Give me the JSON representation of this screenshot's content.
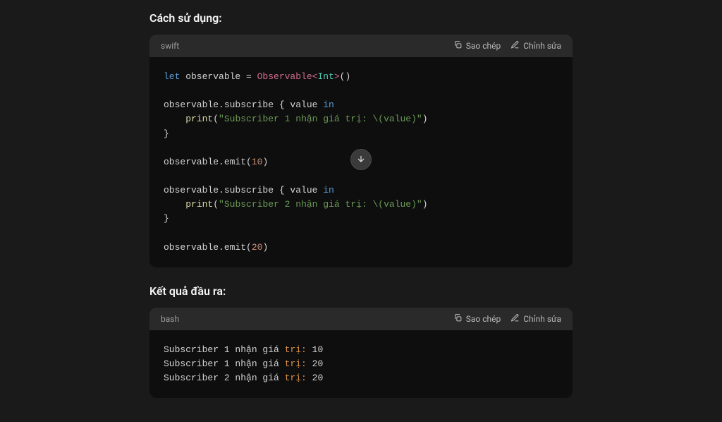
{
  "section1": {
    "heading": "Cách sử dụng:",
    "lang": "swift",
    "copy": "Sao chép",
    "edit": "Chỉnh sửa",
    "tokens": {
      "let": "let",
      "observable": " observable = ",
      "Observable": "Observable",
      "lt": "<",
      "Int": "Int",
      "gt": ">",
      "parens": "()",
      "line3a": "observable.subscribe { value ",
      "in": "in",
      "print": "print",
      "open": "(",
      "str1": "\"Subscriber 1 nhận giá trị: \\(value)\"",
      "close": ")",
      "brace": "}",
      "line7a": "observable.emit(",
      "ten": "10",
      "closeParen": ")",
      "line9a": "observable.subscribe { value ",
      "str2": "\"Subscriber 2 nhận giá trị: \\(value)\"",
      "line13a": "observable.emit(",
      "twenty": "20"
    }
  },
  "section2": {
    "heading": "Kết quả đầu ra:",
    "lang": "bash",
    "copy": "Sao chép",
    "edit": "Chỉnh sửa",
    "lines": {
      "l1a": "Subscriber 1 nhận giá ",
      "l1b": "trị:",
      "l1c": " 10",
      "l2a": "Subscriber 1 nhận giá ",
      "l2b": "trị:",
      "l2c": " 20",
      "l3a": "Subscriber 2 nhận giá ",
      "l3b": "trị:",
      "l3c": " 20"
    }
  }
}
